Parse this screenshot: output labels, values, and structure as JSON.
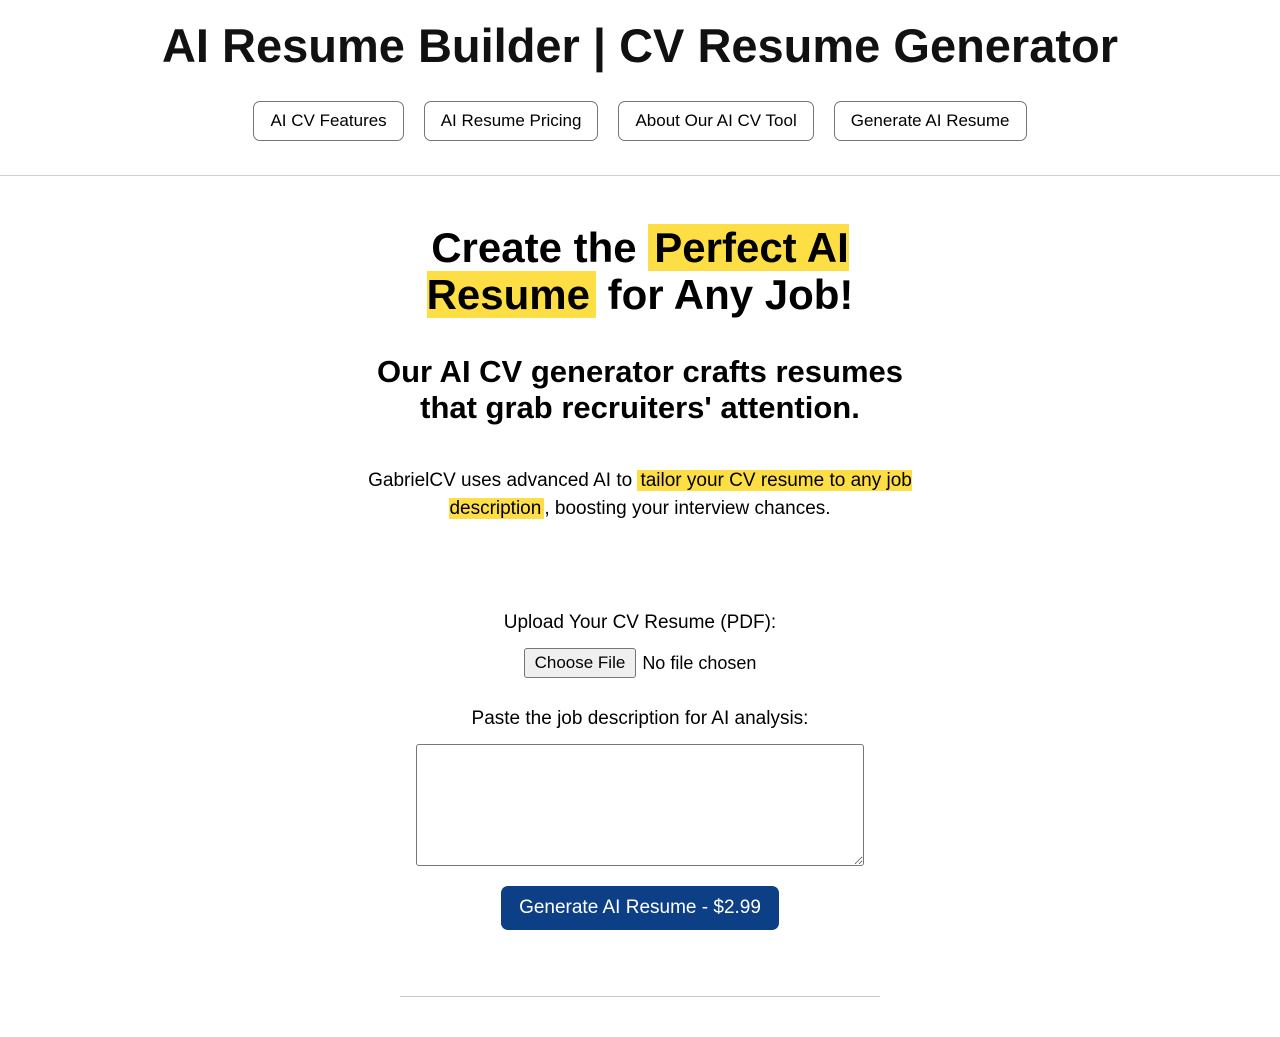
{
  "header": {
    "title": "AI Resume Builder | CV Resume Generator",
    "nav": [
      {
        "label": "AI CV Features"
      },
      {
        "label": "AI Resume Pricing"
      },
      {
        "label": "About Our AI CV Tool"
      },
      {
        "label": "Generate AI Resume"
      }
    ]
  },
  "hero": {
    "prefix": "Create the ",
    "highlight": "Perfect AI Resume",
    "suffix": " for Any Job!"
  },
  "subheading": "Our AI CV generator crafts resumes that grab recruiters' attention.",
  "description": {
    "prefix": "GabrielCV uses advanced AI to ",
    "highlight": "tailor your CV resume to any job description",
    "suffix": ", boosting your interview chances."
  },
  "upload": {
    "label": "Upload Your CV Resume (PDF):",
    "button": "Choose File",
    "status": "No file chosen"
  },
  "paste": {
    "label": "Paste the job description for AI analysis:"
  },
  "generate": {
    "label": "Generate AI Resume - $2.99"
  }
}
